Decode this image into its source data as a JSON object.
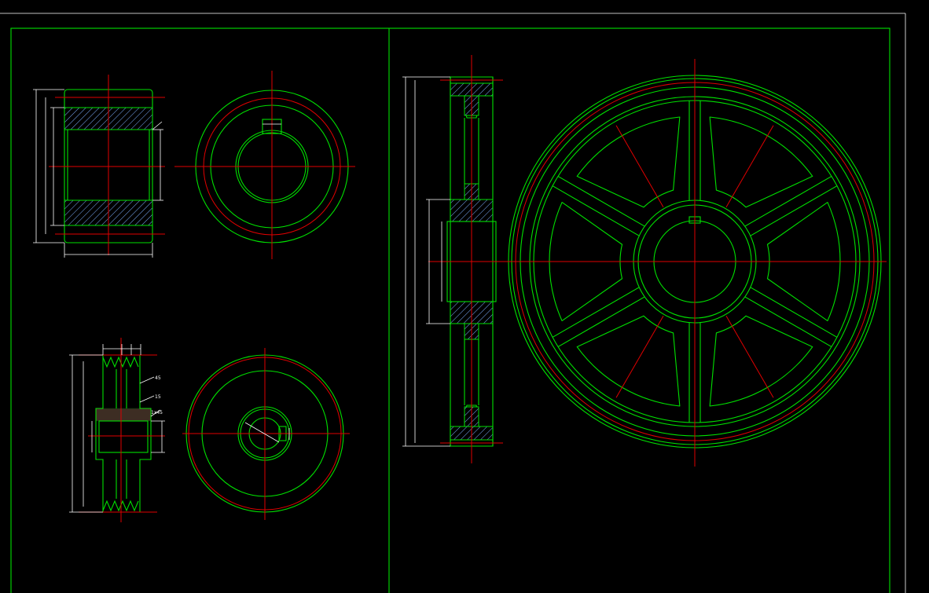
{
  "drawing": {
    "background": "#000000",
    "colors": {
      "outline": "#00e000",
      "centerline": "#e00000",
      "dimension": "#ffffff",
      "hatch": "#7fb0ff"
    },
    "views": [
      {
        "name": "small-gear-section",
        "type": "section-view"
      },
      {
        "name": "small-gear-front",
        "type": "front-view"
      },
      {
        "name": "v-belt-pulley-section",
        "type": "section-view"
      },
      {
        "name": "v-belt-pulley-front",
        "type": "front-view"
      },
      {
        "name": "large-spoked-wheel-section",
        "type": "section-view"
      },
      {
        "name": "large-spoked-wheel-front",
        "type": "front-view",
        "spokes": 6
      }
    ],
    "labels": {
      "chamfer_a": "45",
      "chamfer_b": "15",
      "chamfer_c": "1x45"
    }
  }
}
